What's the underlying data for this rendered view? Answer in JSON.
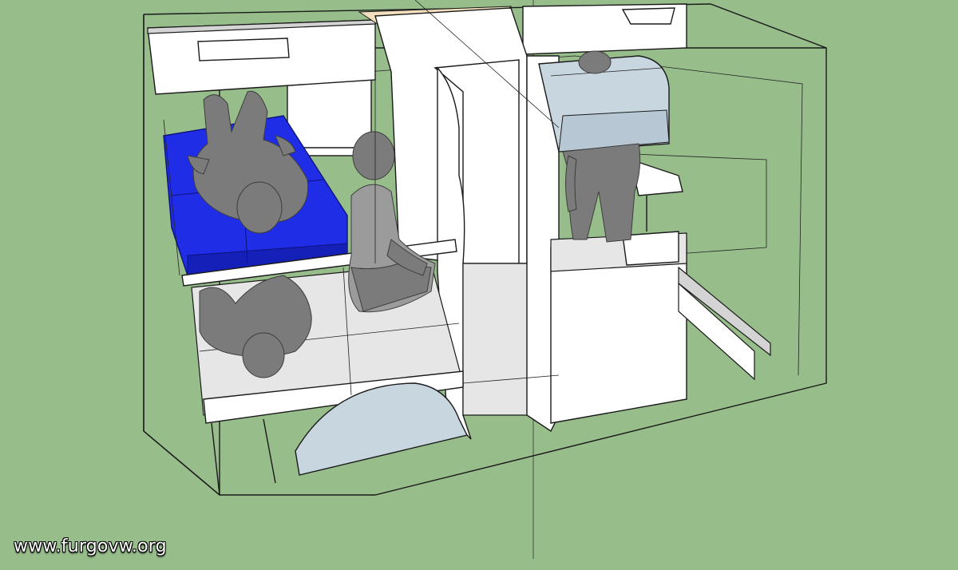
{
  "watermark": {
    "text": "www.furgovw.org"
  },
  "colors": {
    "background": "#97bd8b",
    "mattress": "#1f2ee6",
    "mattress_dark": "#1520b8",
    "cabinet": "#ffffff",
    "panel": "#e6e6e6",
    "glass": "#c8d6e0",
    "figure": "#7b7b7b"
  },
  "icons": [
    "seated-person-icon",
    "lying-person-icon",
    "standing-person-icon"
  ]
}
